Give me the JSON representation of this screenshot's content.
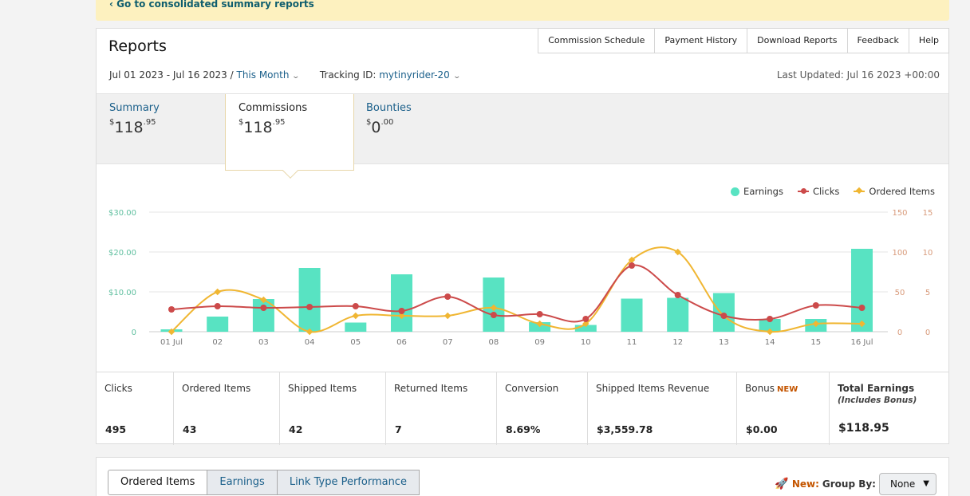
{
  "banner": {
    "link": "‹ Go to consolidated summary reports"
  },
  "reports": {
    "title": "Reports",
    "nav": [
      "Commission Schedule",
      "Payment History",
      "Download Reports",
      "Feedback",
      "Help"
    ],
    "date_range": "Jul 01 2023 - Jul 16 2023 /",
    "period": "This Month",
    "tracking_label": "Tracking ID:",
    "tracking_id": "mytinyrider-20",
    "last_updated": "Last Updated: Jul 16 2023 +00:00"
  },
  "tabs": [
    {
      "label": "Summary",
      "currency": "$",
      "whole": "118",
      "cents": ".95"
    },
    {
      "label": "Commissions",
      "currency": "$",
      "whole": "118",
      "cents": ".95"
    },
    {
      "label": "Bounties",
      "currency": "$",
      "whole": "0",
      "cents": ".00"
    }
  ],
  "legend": {
    "earnings": "Earnings",
    "clicks": "Clicks",
    "ordered": "Ordered Items"
  },
  "colors": {
    "earnings": "#58e3c2",
    "clicks": "#cc4a4a",
    "ordered": "#f0b632",
    "left_axis": "#5fbf9f",
    "right_axis": "#d89a7a"
  },
  "chart_data": {
    "type": "bar",
    "categories": [
      "01 Jul",
      "02",
      "03",
      "04",
      "05",
      "06",
      "07",
      "08",
      "09",
      "10",
      "11",
      "12",
      "13",
      "14",
      "15",
      "16 Jul"
    ],
    "series": [
      {
        "name": "Earnings",
        "type": "bar",
        "axis": "left",
        "values": [
          0.6,
          3.8,
          8.2,
          16.0,
          2.3,
          14.4,
          0,
          13.6,
          2.4,
          1.7,
          8.3,
          8.5,
          9.7,
          3.2,
          3.2,
          20.8
        ]
      },
      {
        "name": "Clicks",
        "type": "line",
        "axis": "right1",
        "values": [
          28,
          32,
          30,
          31,
          32,
          26,
          44,
          21,
          22,
          16,
          83,
          46,
          20,
          16,
          33,
          30
        ]
      },
      {
        "name": "Ordered Items",
        "type": "line",
        "axis": "right2",
        "values": [
          0,
          5,
          4,
          0,
          2,
          2,
          2,
          3,
          1,
          1,
          9,
          10,
          2,
          0,
          1,
          1
        ]
      }
    ],
    "left_ticks": [
      "$30.00",
      "$20.00",
      "$10.00",
      "0"
    ],
    "right1_ticks": [
      "150",
      "100",
      "50",
      "0"
    ],
    "right2_ticks": [
      "15",
      "10",
      "5",
      "0"
    ],
    "ylim_left": [
      0,
      30
    ],
    "ylim_right1": [
      0,
      150
    ],
    "ylim_right2": [
      0,
      15
    ]
  },
  "stats": [
    {
      "label": "Clicks",
      "value": "495"
    },
    {
      "label": "Ordered Items",
      "value": "43"
    },
    {
      "label": "Shipped Items",
      "value": "42"
    },
    {
      "label": "Returned Items",
      "value": "7"
    },
    {
      "label": "Conversion",
      "value": "8.69%"
    },
    {
      "label": "Shipped Items Revenue",
      "value": "$3,559.78"
    },
    {
      "label": "Bonus",
      "badge": "NEW",
      "value": "$0.00"
    },
    {
      "label": "Total Earnings",
      "sub": "(Includes Bonus)",
      "value": "$118.95"
    }
  ],
  "bottom": {
    "tabs": [
      "Ordered Items",
      "Earnings",
      "Link Type Performance"
    ],
    "new_label": "New:",
    "group_label": "Group By:",
    "group_value": "None"
  }
}
